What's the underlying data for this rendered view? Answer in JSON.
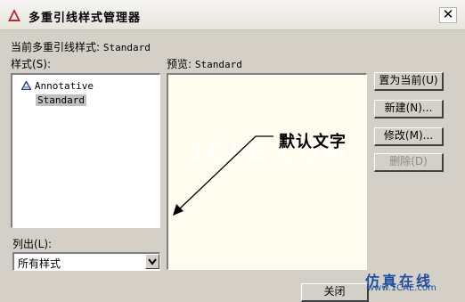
{
  "window": {
    "title": "多重引线样式管理器",
    "close_glyph": "✕"
  },
  "current_style": {
    "label": "当前多重引线样式:",
    "value": "Standard"
  },
  "styles": {
    "label": "样式(S):",
    "items": [
      {
        "label": "Annotative",
        "icon": "annotative-icon"
      },
      {
        "label": "Standard",
        "selected": true
      }
    ]
  },
  "preview": {
    "label": "预览:",
    "style": "Standard",
    "text": "默认文字"
  },
  "buttons": {
    "set_current": "置为当前(U)",
    "new": "新建(N)...",
    "modify": "修改(M)...",
    "delete": "删除(D)",
    "close": "关闭"
  },
  "list_filter": {
    "label": "列出(L):",
    "value": "所有样式"
  },
  "watermark": {
    "text": "1CAE.COM",
    "footer": "仿真在线",
    "url": "www.1CAE.com"
  },
  "colors": {
    "dialog_bg": "#d4d0c8",
    "preview_bg": "#fffdf0",
    "selection_bg": "#c0c0c0"
  }
}
